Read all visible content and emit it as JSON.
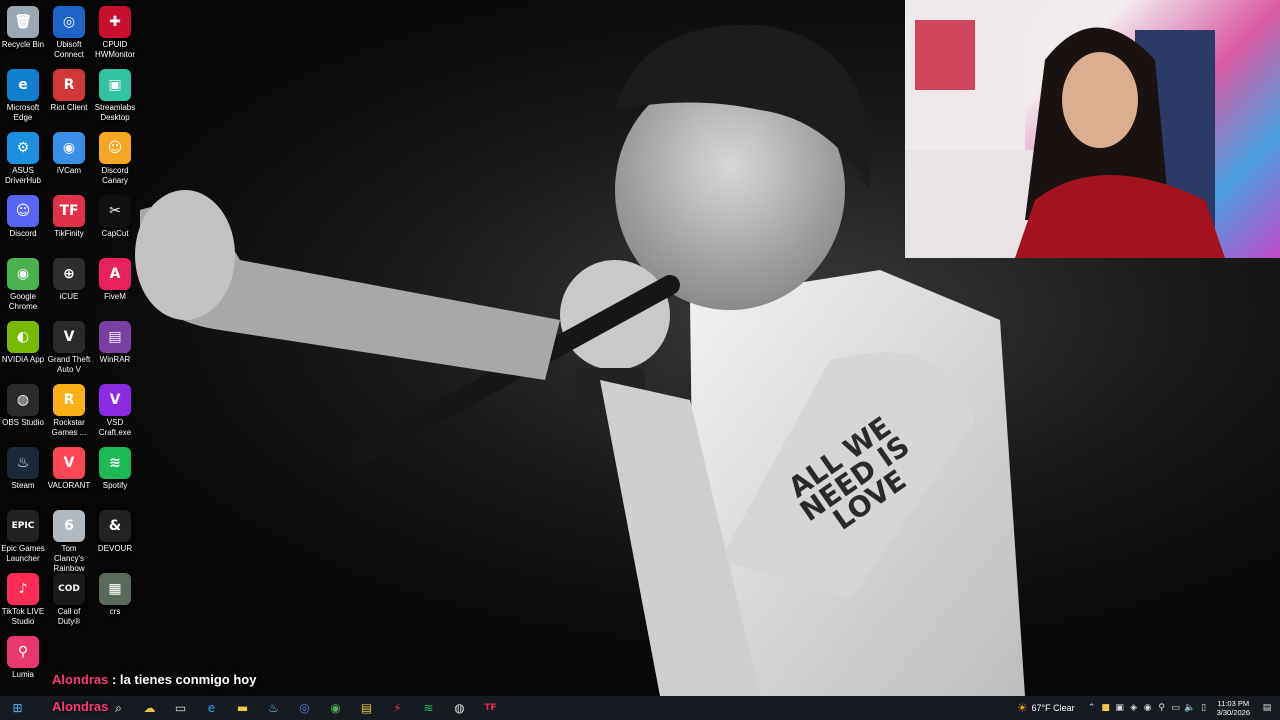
{
  "desktop_icons": [
    {
      "label": "Recycle Bin",
      "glyph": "🗑",
      "color": "#9aa7b5"
    },
    {
      "label": "Ubisoft\nConnect",
      "glyph": "◎",
      "color": "#1d63c8"
    },
    {
      "label": "CPUID\nHWMonitor",
      "glyph": "✚",
      "color": "#c8102e"
    },
    {
      "label": "Microsoft\nEdge",
      "glyph": "e",
      "color": "#0f7fce"
    },
    {
      "label": "Riot Client",
      "glyph": "R",
      "color": "#d13639"
    },
    {
      "label": "Streamlabs\nDesktop",
      "glyph": "▣",
      "color": "#31c3a2"
    },
    {
      "label": "ASUS\nDriverHub",
      "glyph": "⚙",
      "color": "#1d8fe0"
    },
    {
      "label": "iVCam",
      "glyph": "◉",
      "color": "#3a8ee6"
    },
    {
      "label": "Discord\nCanary",
      "glyph": "☺",
      "color": "#f5a623"
    },
    {
      "label": "Discord",
      "glyph": "☺",
      "color": "#5865f2"
    },
    {
      "label": "TikFinity",
      "glyph": "TF",
      "color": "#e2324a"
    },
    {
      "label": "CapCut",
      "glyph": "✂",
      "color": "#111111"
    },
    {
      "label": "Google\nChrome",
      "glyph": "◉",
      "color": "#4caf50"
    },
    {
      "label": "iCUE",
      "glyph": "⊕",
      "color": "#2e2e2e"
    },
    {
      "label": "FiveM",
      "glyph": "A",
      "color": "#e6215b"
    },
    {
      "label": "NVIDIA App",
      "glyph": "◐",
      "color": "#76b900"
    },
    {
      "label": "Grand Theft\nAuto V",
      "glyph": "V",
      "color": "#2a2a2a"
    },
    {
      "label": "WinRAR",
      "glyph": "▤",
      "color": "#7a3fa0"
    },
    {
      "label": "OBS Studio",
      "glyph": "◍",
      "color": "#2b2b2b"
    },
    {
      "label": "Rockstar\nGames ...",
      "glyph": "R",
      "color": "#fcaf17"
    },
    {
      "label": "VSD\nCraft.exe",
      "glyph": "V",
      "color": "#8a2be2"
    },
    {
      "label": "Steam",
      "glyph": "♨",
      "color": "#1b2838"
    },
    {
      "label": "VALORANT",
      "glyph": "V",
      "color": "#ff4655"
    },
    {
      "label": "Spotify",
      "glyph": "≋",
      "color": "#1db954"
    },
    {
      "label": "Epic Games\nLauncher",
      "glyph": "EPIC",
      "color": "#222222"
    },
    {
      "label": "Tom Clancy's\nRainbow Si...",
      "glyph": "6",
      "color": "#b0b8c0"
    },
    {
      "label": "DEVOUR",
      "glyph": "&",
      "color": "#222222"
    },
    {
      "label": "TikTok LIVE\nStudio",
      "glyph": "♪",
      "color": "#fe2c55"
    },
    {
      "label": "Call of\nDuty®",
      "glyph": "COD",
      "color": "#1a1a1a"
    },
    {
      "label": "crs",
      "glyph": "▦",
      "color": "#5a6a5a"
    },
    {
      "label": "Lumia",
      "glyph": "⚲",
      "color": "#e8386d"
    }
  ],
  "wallpaper": {
    "tattoo_text": "ALL WE NEED IS LOVE"
  },
  "chat": {
    "username": "Alondras",
    "separator": " : ",
    "message": "la tienes conmigo hoy",
    "ghost_username": "Alondras"
  },
  "taskbar": {
    "apps": [
      {
        "name": "start",
        "glyph": "⊞",
        "color": "#4fb3ff"
      },
      {
        "name": "search",
        "glyph": "⌕",
        "color": "#ffffff"
      },
      {
        "name": "widgets",
        "glyph": "☁",
        "color": "#f0c04a"
      },
      {
        "name": "task-view",
        "glyph": "▭",
        "color": "#dddddd"
      },
      {
        "name": "edge",
        "glyph": "e",
        "color": "#2f9be6"
      },
      {
        "name": "explorer",
        "glyph": "▬",
        "color": "#f5c842"
      },
      {
        "name": "steam",
        "glyph": "♨",
        "color": "#66c0f4"
      },
      {
        "name": "ubisoft",
        "glyph": "◎",
        "color": "#4a7fe0"
      },
      {
        "name": "chrome",
        "glyph": "◉",
        "color": "#4caf50"
      },
      {
        "name": "notepad",
        "glyph": "▤",
        "color": "#e6c04a"
      },
      {
        "name": "streamlabs",
        "glyph": "⚡",
        "color": "#e03a3a"
      },
      {
        "name": "spotify",
        "glyph": "≋",
        "color": "#1db954"
      },
      {
        "name": "obs",
        "glyph": "◍",
        "color": "#dddddd"
      },
      {
        "name": "tikfinity",
        "glyph": "TF",
        "color": "#e2324a"
      }
    ],
    "weather": {
      "temp": "67°F",
      "condition": "Clear"
    },
    "clock": {
      "time": "11:03 PM",
      "date": "3/30/2026"
    }
  }
}
